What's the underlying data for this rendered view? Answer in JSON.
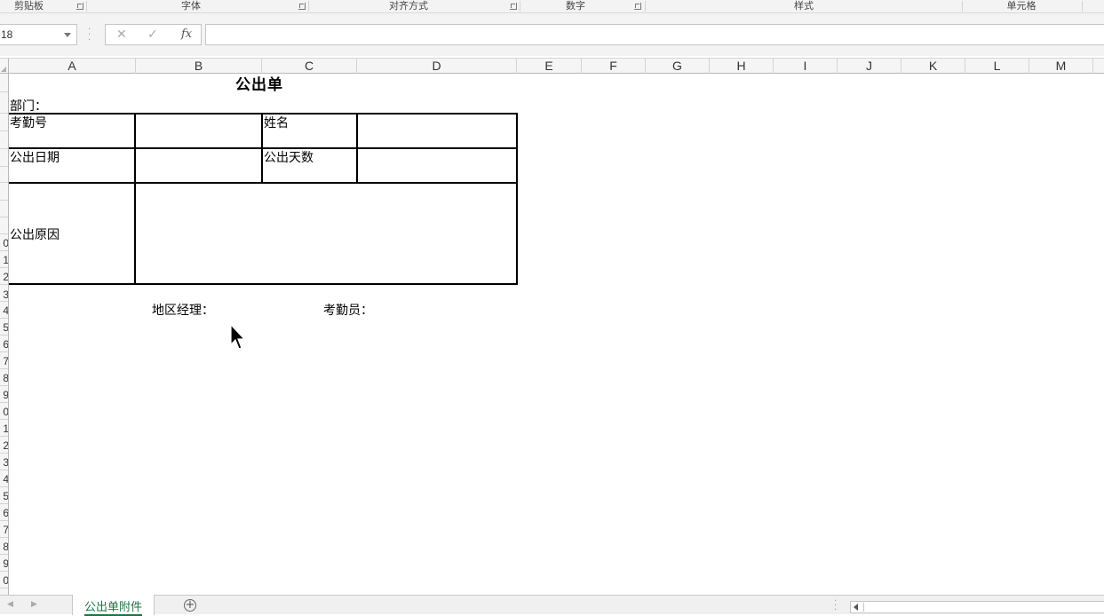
{
  "ribbon": {
    "groups": [
      "剪贴板",
      "字体",
      "对齐方式",
      "数字",
      "样式",
      "单元格"
    ]
  },
  "formula_bar": {
    "name_box": "18",
    "cancel_icon": "✕",
    "enter_icon": "✓",
    "fx_label": "fx",
    "formula": ""
  },
  "columns": [
    "A",
    "B",
    "C",
    "D",
    "E",
    "F",
    "G",
    "H",
    "I",
    "J",
    "K",
    "L",
    "M"
  ],
  "rows": [
    "0",
    "1",
    "2",
    "3",
    "4",
    "5",
    "6",
    "7",
    "8",
    "9",
    "0",
    "1",
    "2",
    "3",
    "4",
    "5",
    "6",
    "7",
    "8",
    "9",
    "0"
  ],
  "sheet": {
    "title": "公出单",
    "department_label": "部门：",
    "attendance_no_label": "考勤号",
    "name_label": "姓名",
    "out_date_label": "公出日期",
    "out_days_label": "公出天数",
    "out_reason_label": "公出原因",
    "regional_manager_label": "地区经理：",
    "attendance_clerk_label": "考勤员："
  },
  "tabs": {
    "active_sheet": "公出单附件",
    "add_icon": "+"
  },
  "icons": {
    "cursor": "arrow-cursor-icon",
    "add_sheet": "plus-circle-icon"
  },
  "colors": {
    "accent": "#217346"
  }
}
